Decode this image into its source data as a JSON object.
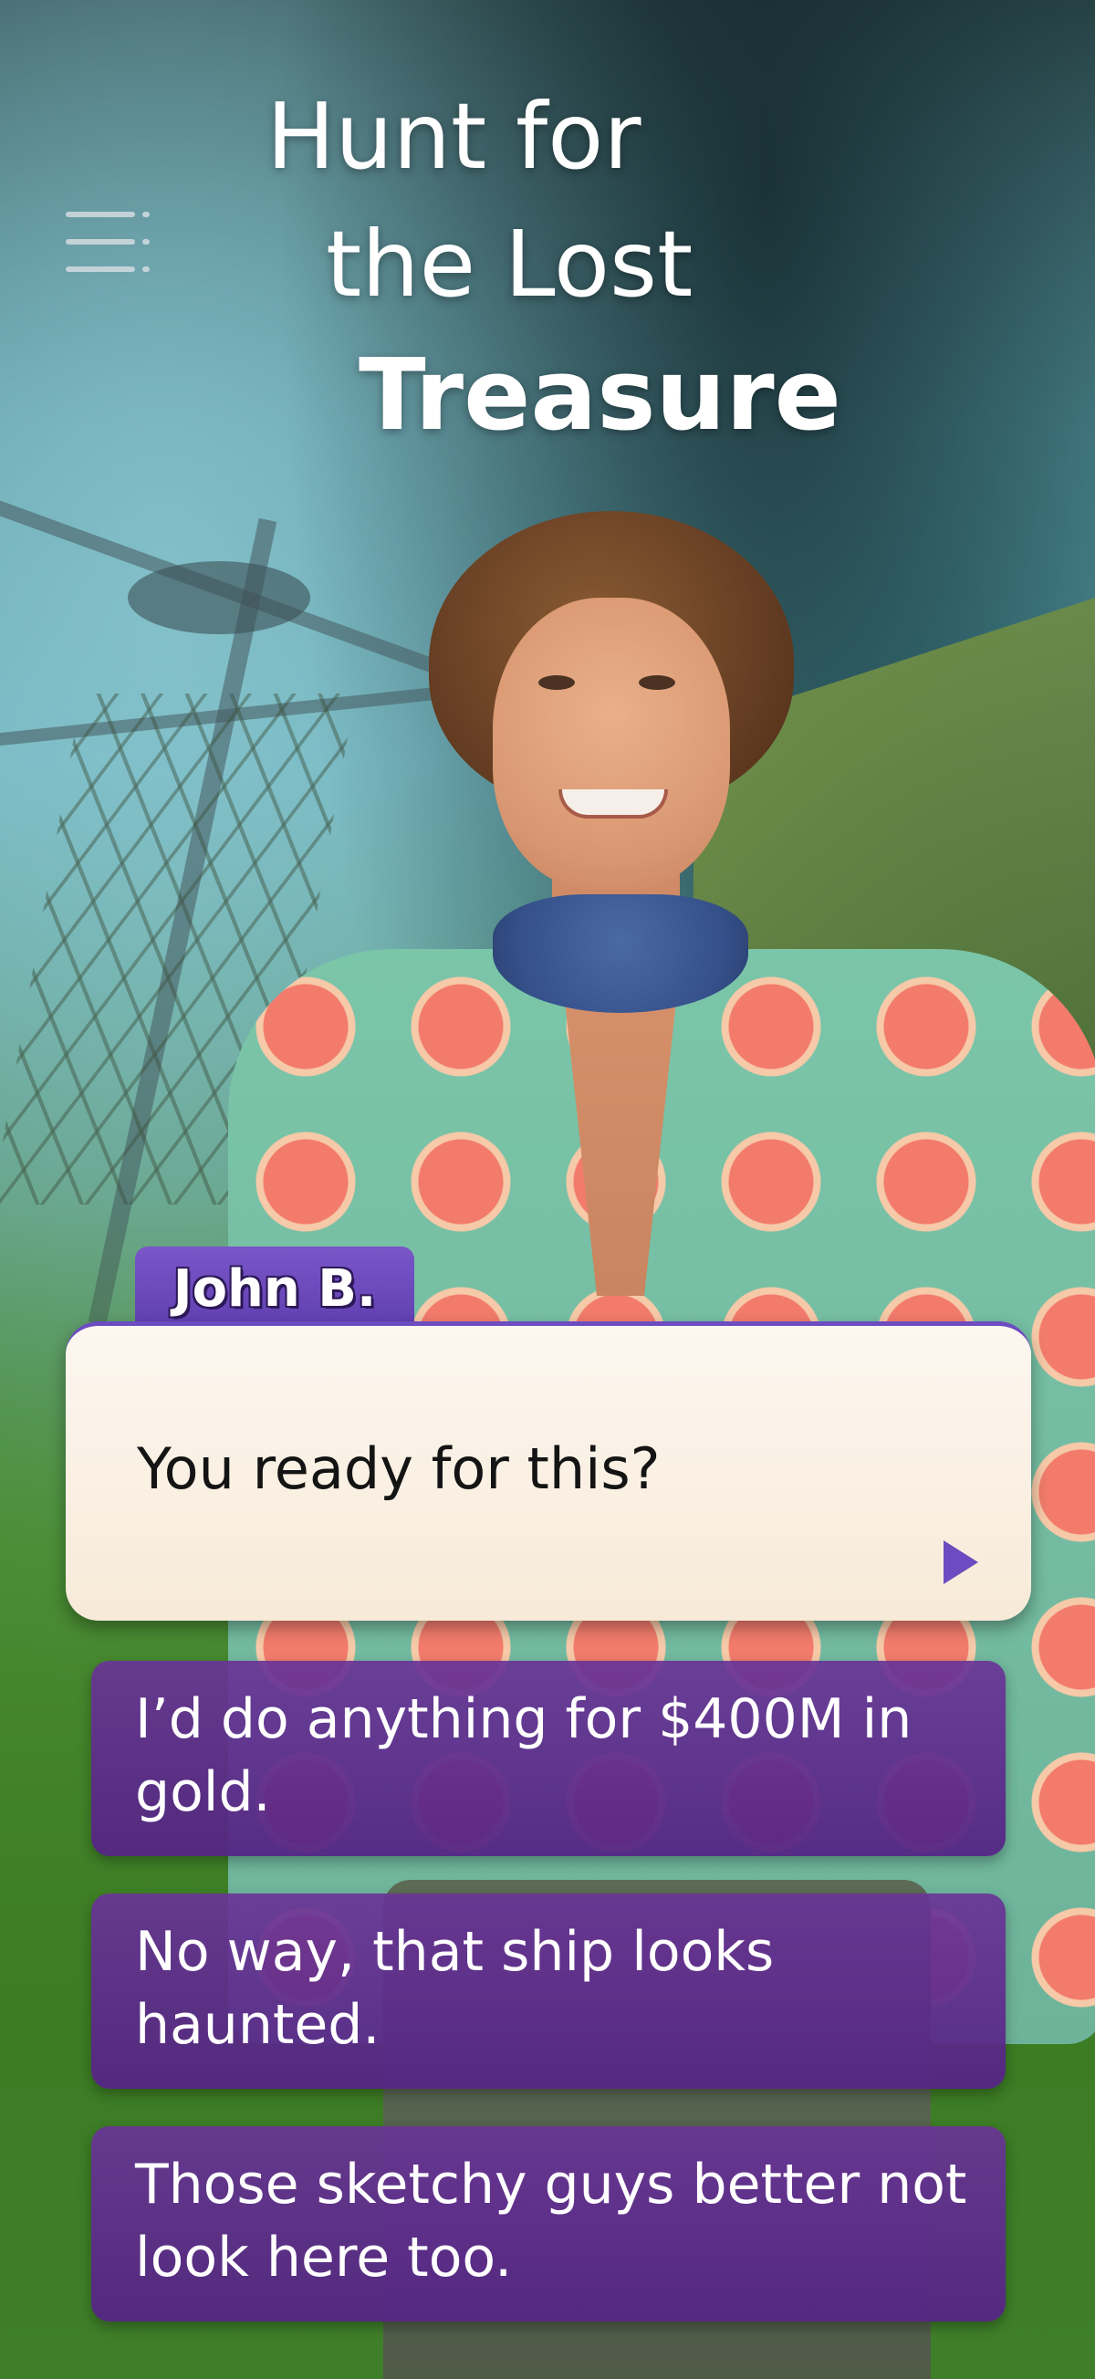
{
  "title": {
    "line1": "Hunt for",
    "line2": "the Lost",
    "line3": "Treasure"
  },
  "menu": {
    "icon": "hamburger-menu-icon"
  },
  "dialogue": {
    "speaker": "John B.",
    "text": "You ready for this?",
    "next_icon": "play-triangle-icon"
  },
  "choices": [
    {
      "text": "I’d do anything for $400M in gold."
    },
    {
      "text": "No way, that ship looks haunted."
    },
    {
      "text": "Those sketchy guys better not look here too."
    }
  ],
  "colors": {
    "accent_purple": "#6c4cc0",
    "choice_purple": "#5a2690",
    "dialog_bg": "#fbf3e8"
  }
}
